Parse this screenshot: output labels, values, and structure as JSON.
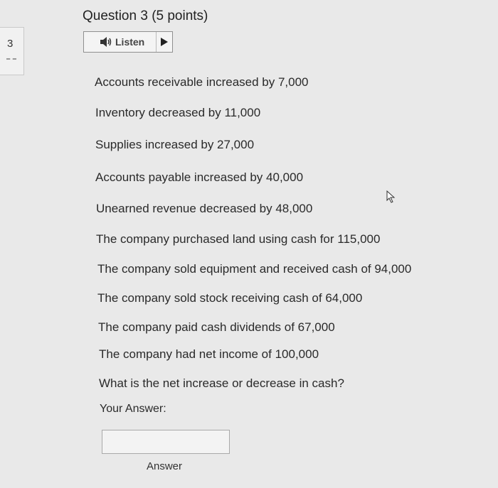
{
  "question": {
    "number": "3",
    "title": "Question 3",
    "points": "(5 points)"
  },
  "listen": {
    "label": "Listen"
  },
  "lines": [
    "Accounts receivable increased by 7,000",
    "Inventory decreased by 11,000",
    "Supplies increased by 27,000",
    "Accounts payable increased by 40,000",
    "Unearned revenue decreased by 48,000",
    "The company purchased land using cash for 115,000",
    "The company sold equipment and received cash of 94,000",
    "The company sold stock receiving cash of 64,000",
    "The company paid cash dividends of 67,000",
    "The company had net income of 100,000",
    "What is the net increase or decrease in cash?"
  ],
  "your_answer_label": "Your Answer:",
  "answer_input": {
    "value": ""
  },
  "answer_label": "Answer",
  "icons": [
    "speaker-icon",
    "play-icon",
    "mouse-cursor-icon",
    "flag-icon"
  ]
}
